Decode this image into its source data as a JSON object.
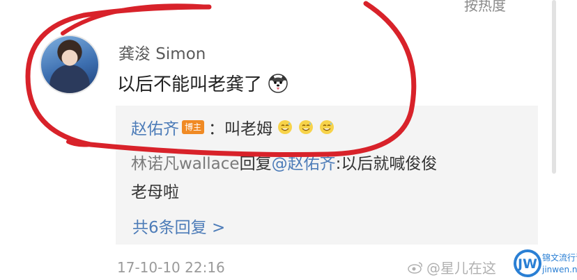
{
  "header": {
    "sort_label": "按热度"
  },
  "comment": {
    "username": "龚浚 Simon",
    "text": "以后不能叫老龚了",
    "icon": "husky-face-icon"
  },
  "replies": {
    "reply1": {
      "author": "赵佑齐",
      "badge": "博主",
      "text": "：叫老姆"
    },
    "reply2": {
      "author": "林诺凡wallace",
      "action": " 回复 ",
      "mention": "@赵佑齐",
      "text_line1": ":以后就喊俊俊",
      "text_line2": "老母啦"
    },
    "more_label": "共6条回复 >"
  },
  "footer": {
    "timestamp": "17-10-10 22:16"
  },
  "watermarks": {
    "weibo": "@星儿在这",
    "site_cn": "锦文流行语",
    "site_en": "jinwen.net"
  },
  "colors": {
    "link_blue": "#4d7cb8",
    "badge_orange": "#f08a24",
    "annotation_red": "#d8222a"
  }
}
